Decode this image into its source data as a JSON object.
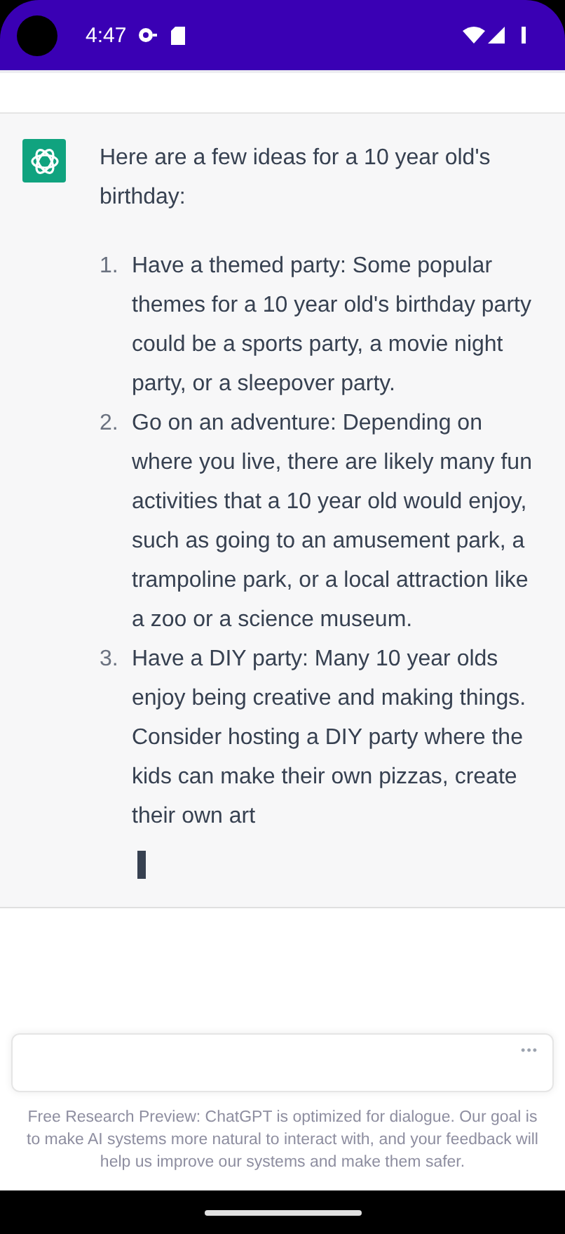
{
  "status_bar": {
    "time": "4:47"
  },
  "message": {
    "intro": "Here are a few ideas for a 10 year old's birthday:",
    "items": [
      {
        "number": "1.",
        "text": "Have a themed party: Some popular themes for a 10 year old's birthday party could be a sports party, a movie night party, or a sleepover party."
      },
      {
        "number": "2.",
        "text": "Go on an adventure: Depending on where you live, there are likely many fun activities that a 10 year old would enjoy, such as going to an amusement park, a trampoline park, or a local attraction like a zoo or a science museum."
      },
      {
        "number": "3.",
        "text": "Have a DIY party: Many 10 year olds enjoy being creative and making things. Consider hosting a DIY party where the kids can make their own pizzas, create their own art"
      }
    ]
  },
  "composer": {
    "menu": "•••"
  },
  "footer": "Free Research Preview: ChatGPT is optimized for dialogue. Our goal is to make AI systems more natural to interact with, and your feedback will help us improve our systems and make them safer."
}
